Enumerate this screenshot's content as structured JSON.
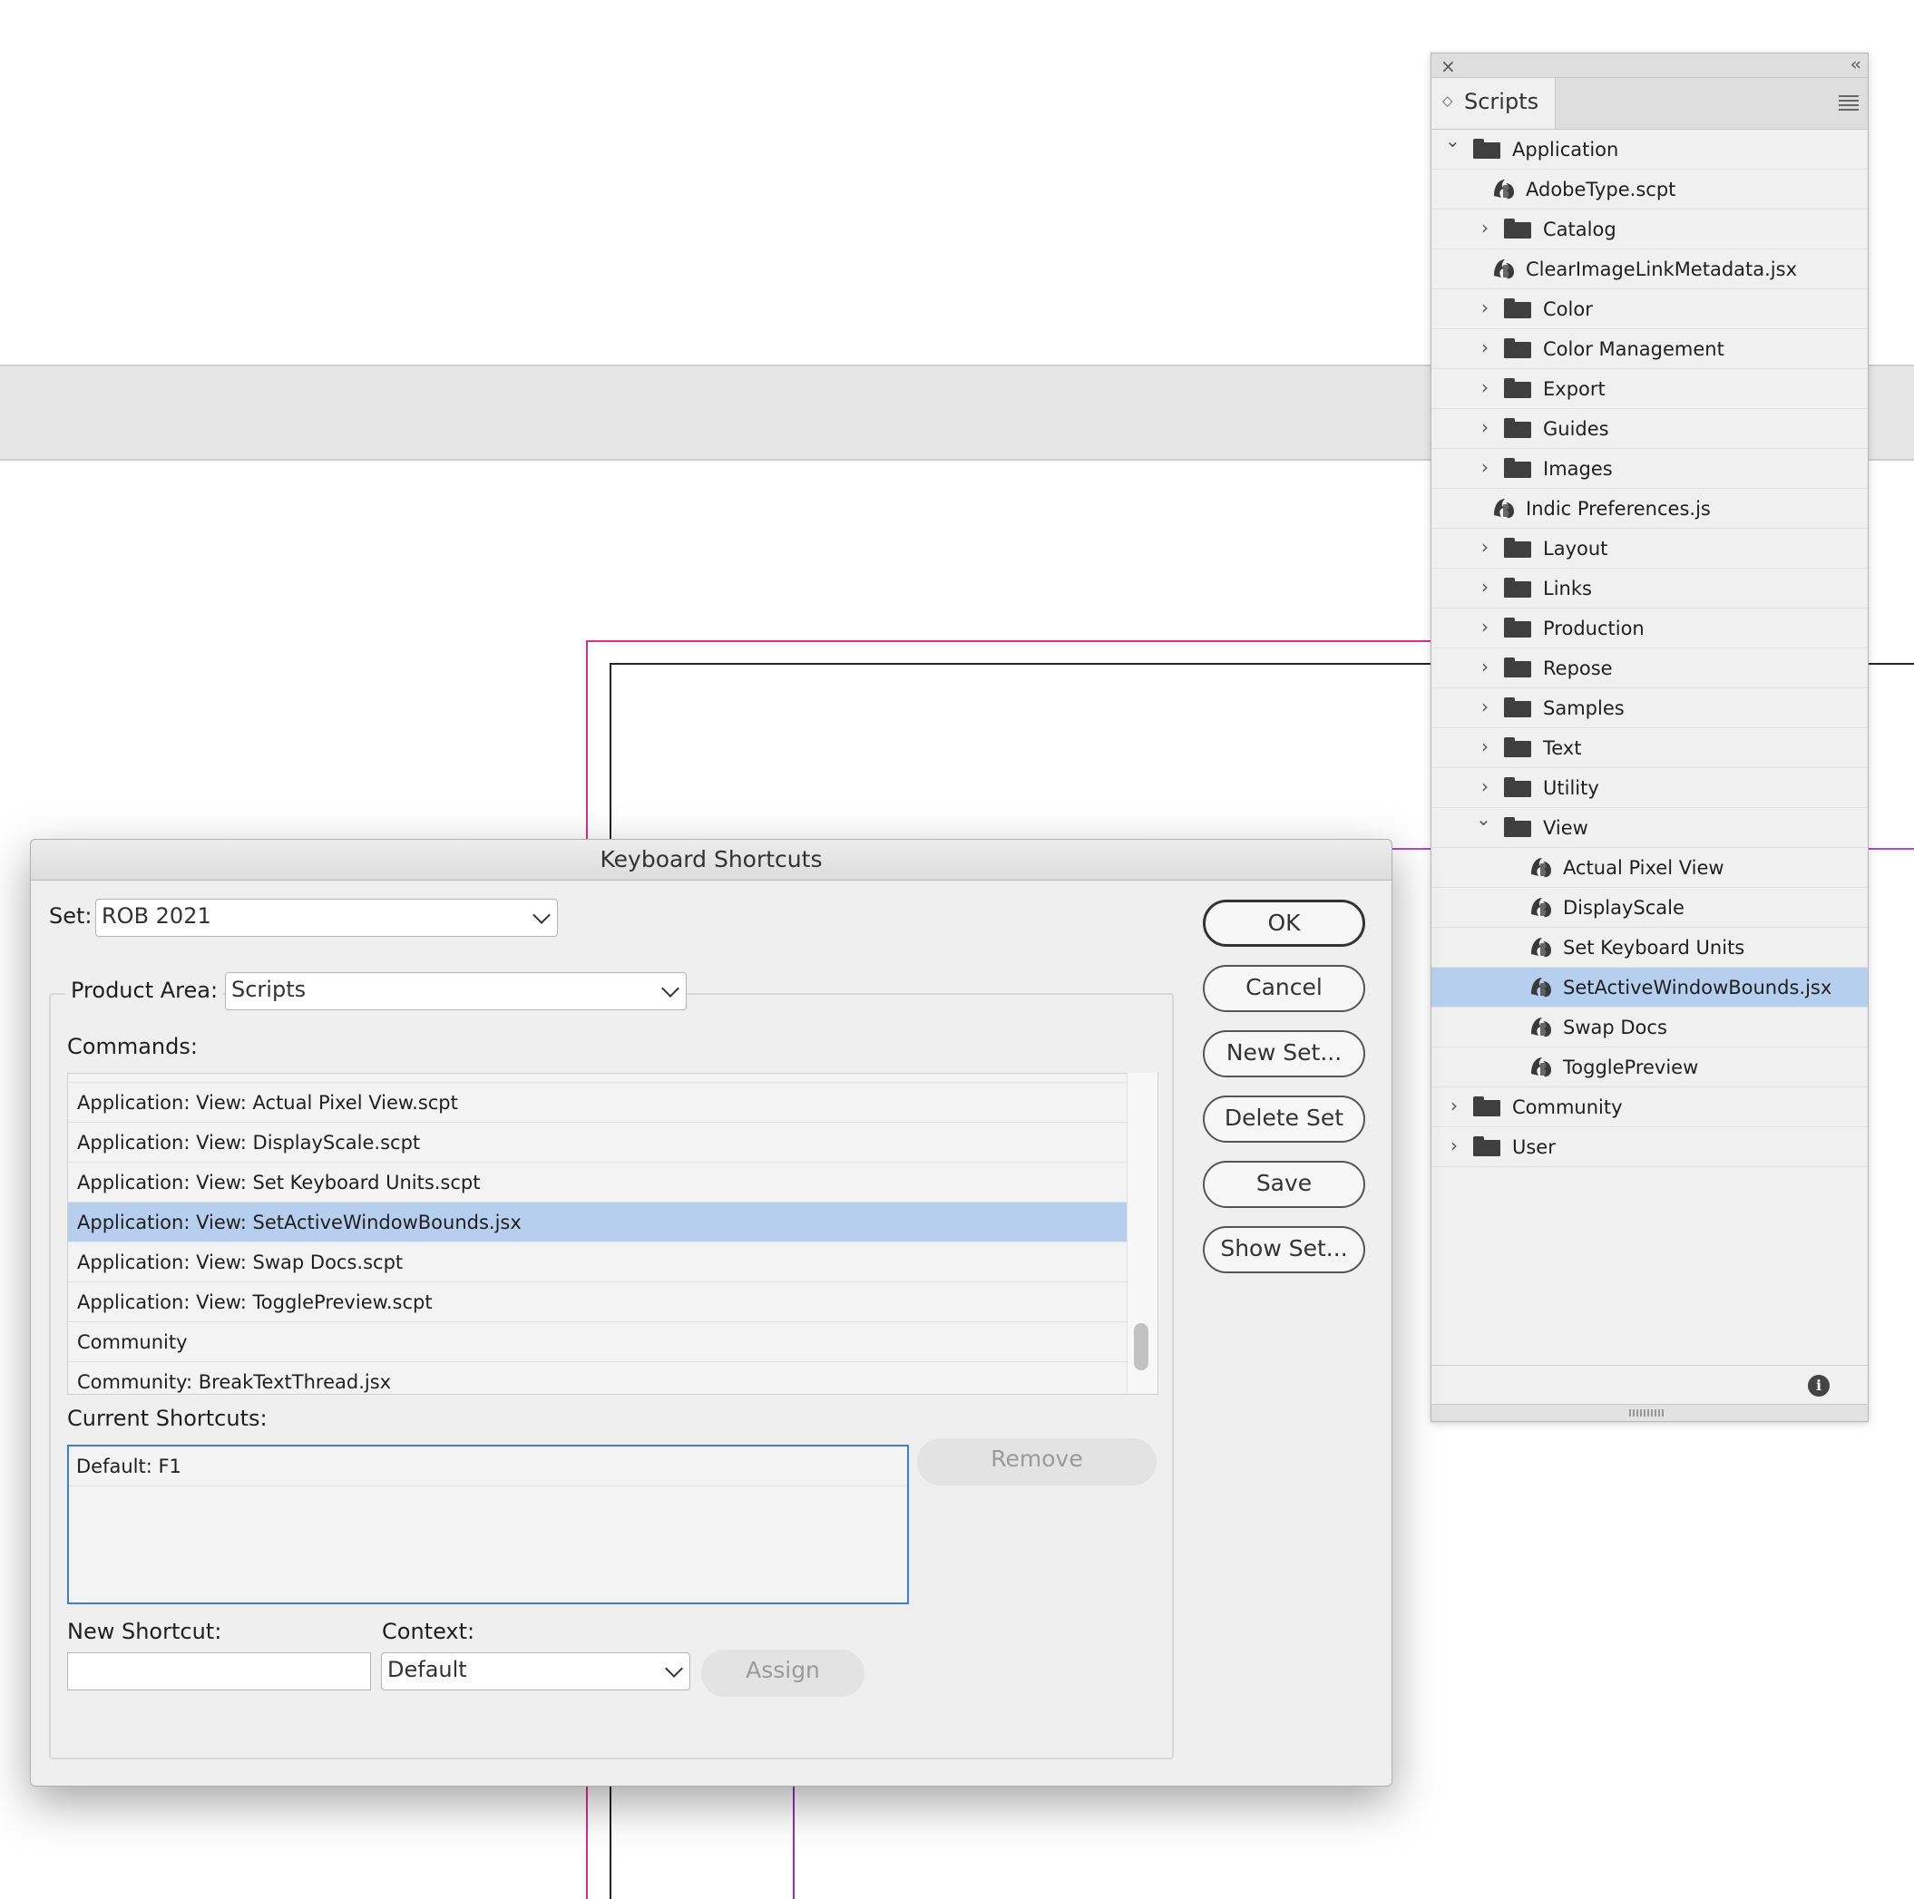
{
  "scripts_panel": {
    "close_glyph": "×",
    "collapse_glyph": "‹‹",
    "tab_label": "Scripts",
    "tab_arrows": "◇",
    "items": [
      {
        "label": "Application",
        "type": "folder",
        "expanded": true,
        "level": 0
      },
      {
        "label": "AdobeType.scpt",
        "type": "script",
        "level": 1
      },
      {
        "label": "Catalog",
        "type": "folder",
        "expanded": false,
        "level": 1
      },
      {
        "label": "ClearImageLinkMetadata.jsx",
        "type": "script",
        "level": 1
      },
      {
        "label": "Color",
        "type": "folder",
        "expanded": false,
        "level": 1
      },
      {
        "label": "Color Management",
        "type": "folder",
        "expanded": false,
        "level": 1
      },
      {
        "label": "Export",
        "type": "folder",
        "expanded": false,
        "level": 1
      },
      {
        "label": "Guides",
        "type": "folder",
        "expanded": false,
        "level": 1
      },
      {
        "label": "Images",
        "type": "folder",
        "expanded": false,
        "level": 1
      },
      {
        "label": "Indic Preferences.js",
        "type": "script",
        "level": 1
      },
      {
        "label": "Layout",
        "type": "folder",
        "expanded": false,
        "level": 1
      },
      {
        "label": "Links",
        "type": "folder",
        "expanded": false,
        "level": 1
      },
      {
        "label": "Production",
        "type": "folder",
        "expanded": false,
        "level": 1
      },
      {
        "label": "Repose",
        "type": "folder",
        "expanded": false,
        "level": 1
      },
      {
        "label": "Samples",
        "type": "folder",
        "expanded": false,
        "level": 1
      },
      {
        "label": "Text",
        "type": "folder",
        "expanded": false,
        "level": 1
      },
      {
        "label": "Utility",
        "type": "folder",
        "expanded": false,
        "level": 1
      },
      {
        "label": "View",
        "type": "folder",
        "expanded": true,
        "level": 1
      },
      {
        "label": "Actual Pixel View",
        "type": "script",
        "level": 2
      },
      {
        "label": "DisplayScale",
        "type": "script",
        "level": 2
      },
      {
        "label": "Set Keyboard Units",
        "type": "script",
        "level": 2
      },
      {
        "label": "SetActiveWindowBounds.jsx",
        "type": "script",
        "level": 2,
        "selected": true
      },
      {
        "label": "Swap Docs",
        "type": "script",
        "level": 2
      },
      {
        "label": "TogglePreview",
        "type": "script",
        "level": 2
      },
      {
        "label": "Community",
        "type": "folder",
        "expanded": false,
        "level": 0
      },
      {
        "label": "User",
        "type": "folder",
        "expanded": false,
        "level": 0
      }
    ],
    "info_glyph": "i"
  },
  "dialog": {
    "title": "Keyboard Shortcuts",
    "set_label": "Set:",
    "set_value": "ROB 2021",
    "product_area_label": "Product Area:",
    "product_area_value": "Scripts",
    "commands_label": "Commands:",
    "commands": [
      {
        "label": "Application: View: Actual Pixel View.scpt"
      },
      {
        "label": "Application: View: DisplayScale.scpt"
      },
      {
        "label": "Application: View: Set Keyboard Units.scpt"
      },
      {
        "label": "Application: View: SetActiveWindowBounds.jsx",
        "selected": true
      },
      {
        "label": "Application: View: Swap Docs.scpt"
      },
      {
        "label": "Application: View: TogglePreview.scpt"
      },
      {
        "label": "Community"
      },
      {
        "label": "Community: BreakTextThread.jsx"
      }
    ],
    "current_shortcuts_label": "Current Shortcuts:",
    "current_shortcuts": [
      "Default: F1"
    ],
    "remove_label": "Remove",
    "new_shortcut_label": "New Shortcut:",
    "new_shortcut_value": "",
    "context_label": "Context:",
    "context_value": "Default",
    "assign_label": "Assign",
    "buttons": {
      "ok": "OK",
      "cancel": "Cancel",
      "new_set": "New Set...",
      "delete_set": "Delete Set",
      "save": "Save",
      "show_set": "Show Set..."
    }
  }
}
